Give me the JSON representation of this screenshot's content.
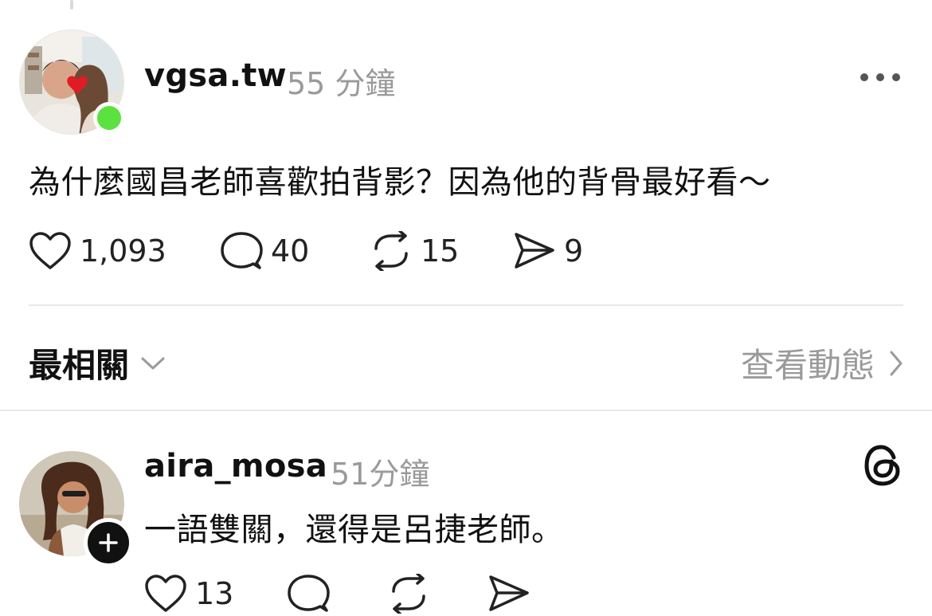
{
  "post": {
    "username": "vgsa.tw",
    "timestamp": "55 分鐘",
    "text": "為什麼國昌老師喜歡拍背影？因為他的背骨最好看～",
    "actions": {
      "likes": "1,093",
      "replies": "40",
      "reposts": "15",
      "shares": "9"
    },
    "online_status_color": "#5be23f"
  },
  "replies_header": {
    "sort_label": "最相關",
    "activity_link": "查看動態"
  },
  "reply": {
    "username": "aira_mosa",
    "timestamp": "51分鐘",
    "text": "一語雙關，還得是呂捷老師。",
    "actions": {
      "likes": "13"
    }
  },
  "icons": [
    "heart-icon",
    "comment-icon",
    "repost-icon",
    "share-icon",
    "more-icon",
    "chevron-down-icon",
    "chevron-right-icon",
    "threads-logo-icon",
    "plus-icon"
  ]
}
